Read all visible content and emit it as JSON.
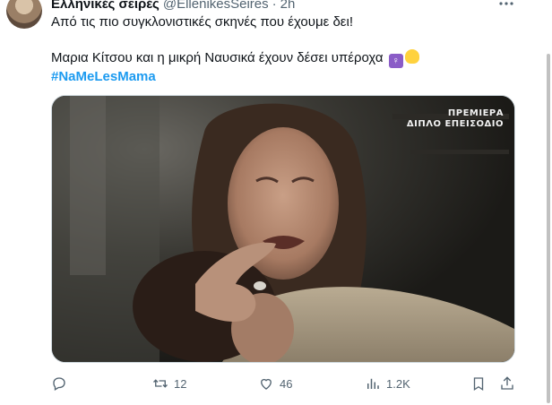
{
  "tweet": {
    "display_name": "Ελληνικές σειρές",
    "handle": "@EllenikesSeires",
    "dot": "·",
    "time": "2h",
    "text_line1": "Από τις πιο συγκλονιστικές σκηνές που έχουμε δει!",
    "text_line2": "Μαρια Κίτσου και η μικρή Ναυσικά έχουν δέσει υπέροχα",
    "hashtag": "#NaMeLesMama",
    "emojis": [
      "woman-holding-child-emoji",
      "clapping-hands-emoji"
    ]
  },
  "media": {
    "overlay_line1": "ΠΡΕΜΙΕΡΑ",
    "overlay_line2": "ΔΙΠΛΟ ΕΠΕΙΣΟΔΙΟ",
    "description_icon": "video-still"
  },
  "actions": {
    "reply": {
      "icon": "reply-icon",
      "count": ""
    },
    "retweet": {
      "icon": "retweet-icon",
      "count": "12"
    },
    "like": {
      "icon": "heart-icon",
      "count": "46"
    },
    "views": {
      "icon": "analytics-icon",
      "count": "1.2K"
    },
    "bookmark": {
      "icon": "bookmark-icon"
    },
    "share": {
      "icon": "share-icon"
    }
  },
  "colors": {
    "text": "#0f1419",
    "secondary": "#536471",
    "link": "#1d9bf0",
    "border": "#cfd9de"
  }
}
